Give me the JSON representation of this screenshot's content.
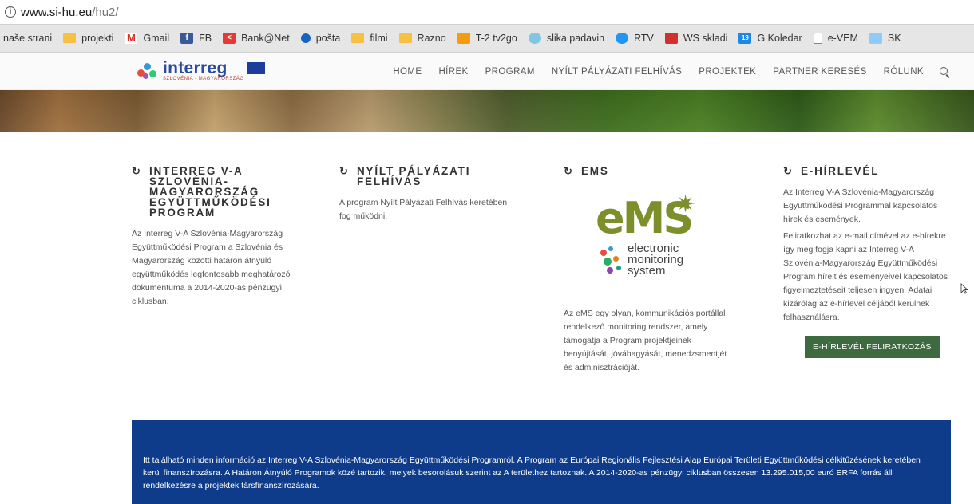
{
  "browser": {
    "url_host": "www.si-hu.eu",
    "url_path": "/hu2/",
    "bookmarks": [
      {
        "label": "naše strani",
        "icon": "none"
      },
      {
        "label": "projekti",
        "icon": "folder-icon"
      },
      {
        "label": "Gmail",
        "icon": "gmail-icon"
      },
      {
        "label": "FB",
        "icon": "facebook-icon"
      },
      {
        "label": "Bank@Net",
        "icon": "bank-icon"
      },
      {
        "label": "pošta",
        "icon": "mail-icon"
      },
      {
        "label": "filmi",
        "icon": "folder-icon"
      },
      {
        "label": "Razno",
        "icon": "folder-icon"
      },
      {
        "label": "T-2 tv2go",
        "icon": "tv-icon"
      },
      {
        "label": "slika padavin",
        "icon": "weather-icon"
      },
      {
        "label": "RTV",
        "icon": "rtv-icon"
      },
      {
        "label": "WS skladi",
        "icon": "ws-icon"
      },
      {
        "label": "G Koledar",
        "icon": "calendar-icon"
      },
      {
        "label": "e-VEM",
        "icon": "document-icon"
      },
      {
        "label": "SK",
        "icon": "evem-icon"
      }
    ]
  },
  "header": {
    "logo_name": "interreg",
    "logo_sub": "SZLOVÉNIA - MAGYARORSZÁG",
    "nav": [
      "HOME",
      "HÍREK",
      "PROGRAM",
      "NYÍLT PÁLYÁZATI FELHÍVÁS",
      "PROJEKTEK",
      "PARTNER KERESÉS",
      "RÓLUNK"
    ]
  },
  "columns": {
    "program": {
      "title": "INTERREG V-A SZLOVÉNIA-MAGYARORSZÁG EGYÜTTMŰKÖDÉSI PROGRAM",
      "text": "Az Interreg V-A Szlovénia-Magyarország Együttműködési Program a Szlovénia és Magyarország közötti határon átnyúló együttműködés legfontosabb meghatározó dokumentuma a 2014-2020-as pénzügyi ciklusban."
    },
    "call": {
      "title": "NYÍLT PÁLYÁZATI FELHÍVÁS",
      "text": "A program Nyílt Pályázati Felhívás keretében fog működni."
    },
    "ems": {
      "title": "EMS",
      "logo_word": "eMS",
      "logo_line1": "electronic",
      "logo_line2": "monitoring",
      "logo_line3": "system",
      "text": "Az eMS egy olyan, kommunikációs portállal rendelkező monitoring rendszer, amely támogatja a Program projektjeinek benyújtását, jóváhagyását, menedzsmentjét és adminisztrációját."
    },
    "newsletter": {
      "title": "E-HÍRLEVÉL",
      "text1": "Az Interreg V-A Szlovénia-Magyarország Együttműködési Programmal kapcsolatos hírek és események.",
      "text2": "Feliratkozhat az e-mail címével az e-hírekre így meg fogja kapni az Interreg V-A Szlovénia-Magyarország Együttműködési Program híreit és eseményeivel kapcsolatos figyelmeztetéseit teljesen ingyen. Adatai kizárólag az e-hírlevél céljából kerülnek felhasználásra.",
      "button": "E-HÍRLEVÉL FELIRATKOZÁS"
    }
  },
  "banner": {
    "text": "Itt található minden információ az Interreg V-A Szlovénia-Magyarország Együttműködési Programról. A Program az Európai Regionális Fejlesztési Alap Európai Területi Együttműködési célkitűzésének keretében kerül finanszírozásra. A Határon Átnyúló Programok közé tartozik, melyek besorolásuk szerint az A területhez tartoznak. A 2014-2020-as pénzügyi ciklusban összesen 13.295.015,00 euró ERFA forrás áll rendelkezésre a projektek társfinanszírozására."
  },
  "colors": {
    "banner": "#0f3c8a",
    "button": "#3d6b3f",
    "ems_green": "#7d8f2b",
    "logo_blue": "#2a4a9e"
  }
}
